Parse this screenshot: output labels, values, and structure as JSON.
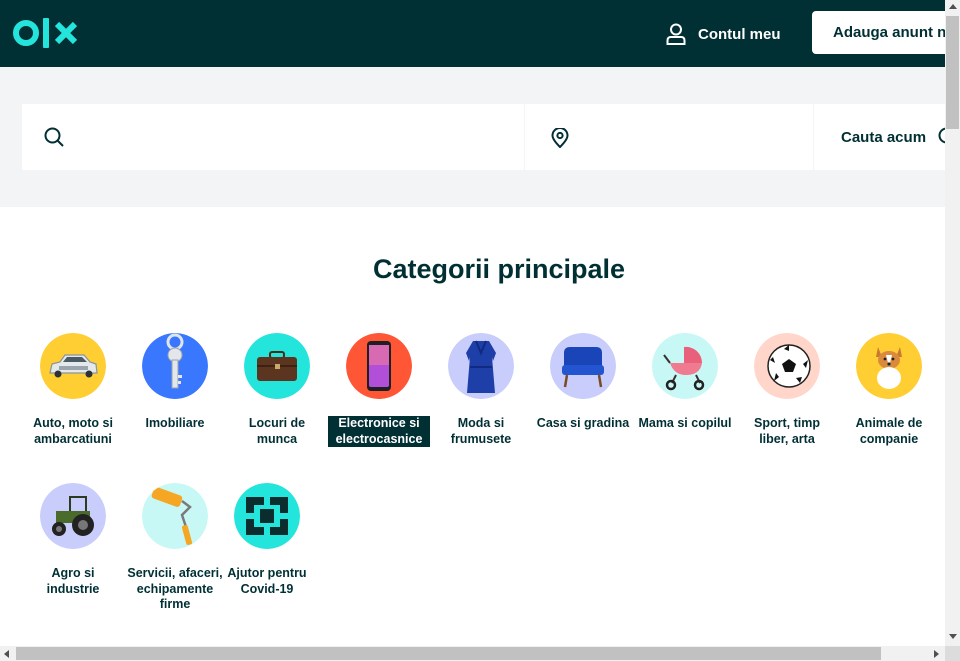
{
  "colors": {
    "brand_dark": "#002f34",
    "brand_teal": "#23e5db",
    "band_bg": "#f2f4f5"
  },
  "header": {
    "logo_text": "olx",
    "account_label": "Contul meu",
    "post_ad_label": "Adauga anunt nou"
  },
  "search": {
    "query_value": "",
    "location_value": "",
    "submit_label": "Cauta acum"
  },
  "categories_section": {
    "title": "Categorii principale",
    "items": [
      {
        "label": "Auto, moto si ambarcatiuni",
        "icon": "car-icon",
        "bg": "#ffce32",
        "active": false
      },
      {
        "label": "Imobiliare",
        "icon": "key-icon",
        "bg": "#3a77ff",
        "active": false
      },
      {
        "label": "Locuri de munca",
        "icon": "briefcase-icon",
        "bg": "#23e5db",
        "active": false
      },
      {
        "label": "Electronice si electrocasnice",
        "icon": "smartphone-icon",
        "bg": "#ff5636",
        "active": true
      },
      {
        "label": "Moda si frumusete",
        "icon": "dress-icon",
        "bg": "#c8cdfb",
        "active": false
      },
      {
        "label": "Casa si gradina",
        "icon": "armchair-icon",
        "bg": "#c8cdfb",
        "active": false
      },
      {
        "label": "Mama si copilul",
        "icon": "stroller-icon",
        "bg": "#c8f8f6",
        "active": false
      },
      {
        "label": "Sport, timp liber, arta",
        "icon": "soccer-ball-icon",
        "bg": "#ffd6c9",
        "active": false
      },
      {
        "label": "Animale de companie",
        "icon": "dog-icon",
        "bg": "#ffce32",
        "active": false
      },
      {
        "label": "Agro si industrie",
        "icon": "tractor-icon",
        "bg": "#c8cdfb",
        "active": false
      },
      {
        "label": "Servicii, afaceri, echipamente firme",
        "icon": "paint-roller-icon",
        "bg": "#c8f8f6",
        "active": false
      },
      {
        "label": "Ajutor pentru Covid-19",
        "icon": "helping-hands-icon",
        "bg": "#23e5db",
        "active": false
      }
    ]
  }
}
